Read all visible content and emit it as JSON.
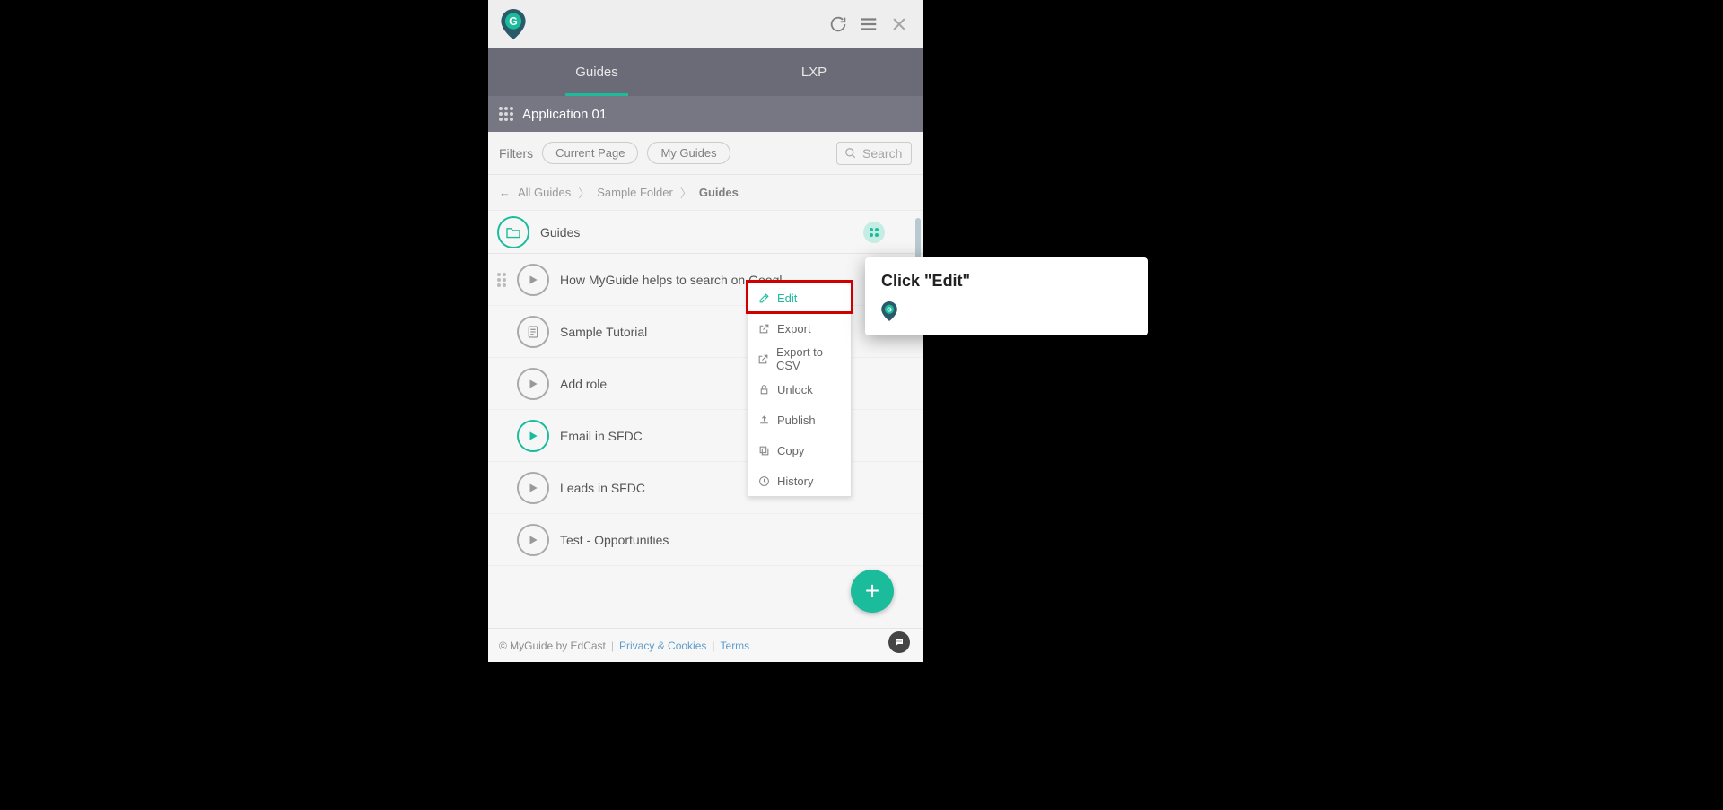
{
  "header": {},
  "tabs": {
    "guides": "Guides",
    "lxp": "LXP"
  },
  "appBar": {
    "name": "Application 01"
  },
  "filters": {
    "label": "Filters",
    "currentPage": "Current Page",
    "myGuides": "My Guides",
    "searchPlaceholder": "Search"
  },
  "breadcrumb": {
    "back": "←",
    "allGuides": "All Guides",
    "folder": "Sample Folder",
    "current": "Guides"
  },
  "folderHeader": {
    "title": "Guides"
  },
  "guides": [
    {
      "title": "How MyGuide helps to search on Googl",
      "icon": "play",
      "active": false,
      "hasDrag": true
    },
    {
      "title": "Sample Tutorial",
      "icon": "doc",
      "active": false,
      "indent": true
    },
    {
      "title": "Add role",
      "icon": "play",
      "active": false,
      "indent": true
    },
    {
      "title": "Email in SFDC",
      "icon": "play",
      "active": true,
      "indent": true
    },
    {
      "title": "Leads in SFDC",
      "icon": "play",
      "active": false,
      "indent": true
    },
    {
      "title": "Test - Opportunities",
      "icon": "play",
      "active": false,
      "indent": true
    }
  ],
  "contextMenu": {
    "edit": "Edit",
    "export": "Export",
    "exportCsv": "Export to CSV",
    "unlock": "Unlock",
    "publish": "Publish",
    "copy": "Copy",
    "history": "History"
  },
  "tooltip": {
    "title": "Click \"Edit\""
  },
  "footer": {
    "copyright": "© MyGuide by EdCast",
    "privacy": "Privacy & Cookies",
    "terms": "Terms"
  },
  "fab": "+"
}
